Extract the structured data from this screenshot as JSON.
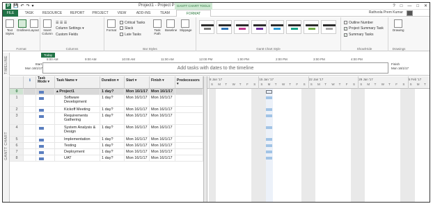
{
  "window": {
    "title": "Project1 - Project Professional",
    "file_tab": "FILE",
    "context_group": "GANTT CHART TOOLS",
    "user": "Rathvola Prem Kumar",
    "qat": {
      "logo": "P",
      "save": "💾",
      "undo": "↶",
      "redo": "↷",
      "more": "▾"
    },
    "buttons": {
      "help": "?",
      "restore": "□",
      "minimize": "—",
      "maximize": "□",
      "close": "✕"
    }
  },
  "tabs": [
    "TASK",
    "RESOURCE",
    "REPORT",
    "PROJECT",
    "VIEW",
    "ADD-INS",
    "TEAM",
    "FORMAT"
  ],
  "ribbon": {
    "format": {
      "label": "Format",
      "text_styles": "Text Styles",
      "gridlines": "Gridlines",
      "layout": "Layout"
    },
    "columns": {
      "label": "Columns",
      "insert_column": "Insert Column",
      "column_settings": "Column Settings ▾",
      "custom_fields": "Custom Fields"
    },
    "bar_styles": {
      "label": "Bar Styles",
      "format": "Format",
      "critical_tasks": "Critical Tasks",
      "slack": "Slack",
      "late_tasks": "Late Tasks",
      "task_path": "Task Path",
      "baseline": "Baseline",
      "slippage": "Slippage"
    },
    "gantt_style": {
      "label": "Gantt Chart Style"
    },
    "show_hide": {
      "label": "Show/Hide",
      "outline_number": "Outline Number",
      "project_summary_task": "Project Summary Task",
      "summary_tasks": "Summary Tasks"
    },
    "drawings": {
      "label": "Drawings",
      "drawing": "Drawing"
    }
  },
  "timeline": {
    "side_label": "TIMELINE",
    "today": "Today",
    "start_label": "Start",
    "start_date": "Mon 16/1/17",
    "finish_label": "Finish",
    "finish_date": "Mon 16/1/17",
    "placeholder": "Add tasks with dates to the timeline",
    "times": [
      "8:00 AM",
      "9:00 AM",
      "10:00 AM",
      "11:00 AM",
      "12:00 PM",
      "1:00 PM",
      "2:00 PM",
      "3:00 PM",
      "4:00 PM"
    ]
  },
  "grid": {
    "side_label": "GANTT CHART",
    "headers": {
      "info": "ℹ",
      "mode": "Task Mode ▾",
      "name": "Task Name ▾",
      "duration": "Duration ▾",
      "start": "Start ▾",
      "finish": "Finish ▾",
      "predecessors": "Predecessors ▾"
    },
    "rows": [
      {
        "id": "0",
        "name": "▴ Project1",
        "duration": "1 day?",
        "start": "Mon 16/1/17",
        "finish": "Mon 16/1/17",
        "summary": true
      },
      {
        "id": "1",
        "name": "Software Development",
        "duration": "1 day?",
        "start": "Mon 16/1/17",
        "finish": "Mon 16/1/17"
      },
      {
        "id": "2",
        "name": "Kickoff Meeting",
        "duration": "1 day?",
        "start": "Mon 16/1/17",
        "finish": "Mon 16/1/17"
      },
      {
        "id": "3",
        "name": "Requirements Gathering",
        "duration": "1 day?",
        "start": "Mon 16/1/17",
        "finish": "Mon 16/1/17"
      },
      {
        "id": "4",
        "name": "System Analysis & Design",
        "duration": "1 day?",
        "start": "Mon 16/1/17",
        "finish": "Mon 16/1/17"
      },
      {
        "id": "5",
        "name": "Implementation",
        "duration": "1 day?",
        "start": "Mon 16/1/17",
        "finish": "Mon 16/1/17"
      },
      {
        "id": "6",
        "name": "Testing",
        "duration": "1 day?",
        "start": "Mon 16/1/17",
        "finish": "Mon 16/1/17"
      },
      {
        "id": "7",
        "name": "Deployment",
        "duration": "1 day?",
        "start": "Mon 16/1/17",
        "finish": "Mon 16/1/17"
      },
      {
        "id": "8",
        "name": "UAT",
        "duration": "1 day?",
        "start": "Mon 16/1/17",
        "finish": "Mon 16/1/17"
      }
    ]
  },
  "chart": {
    "weeks": [
      "8 Jan '17",
      "15 Jan '17",
      "22 Jan '17",
      "29 Jan '17",
      "5 Feb '17"
    ],
    "days": [
      "S",
      "M",
      "T",
      "W",
      "T",
      "F",
      "S"
    ]
  },
  "colors": {
    "brand": "#217346",
    "bar": "#9dc3e6",
    "summary_bg": "#d9d9d9"
  }
}
